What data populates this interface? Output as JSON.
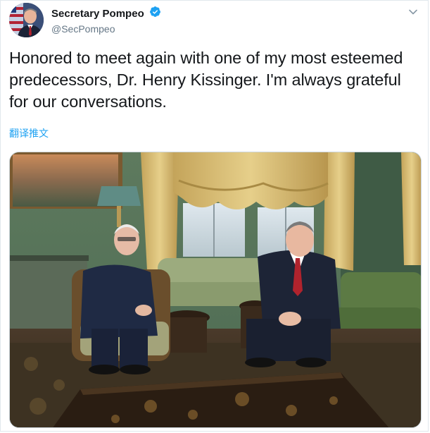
{
  "tweet": {
    "display_name": "Secretary Pompeo",
    "handle": "@SecPompeo",
    "text": "Honored to meet again with one of my most esteemed predecessors, Dr. Henry Kissinger. I'm always grateful for our conversations.",
    "translate_label": "翻译推文"
  },
  "icons": {
    "verified": "verified-badge-icon",
    "menu": "chevron-down-icon"
  },
  "colors": {
    "link": "#1da1f2",
    "verified": "#1da1f2",
    "text": "#14171a",
    "secondary_text": "#657786"
  }
}
